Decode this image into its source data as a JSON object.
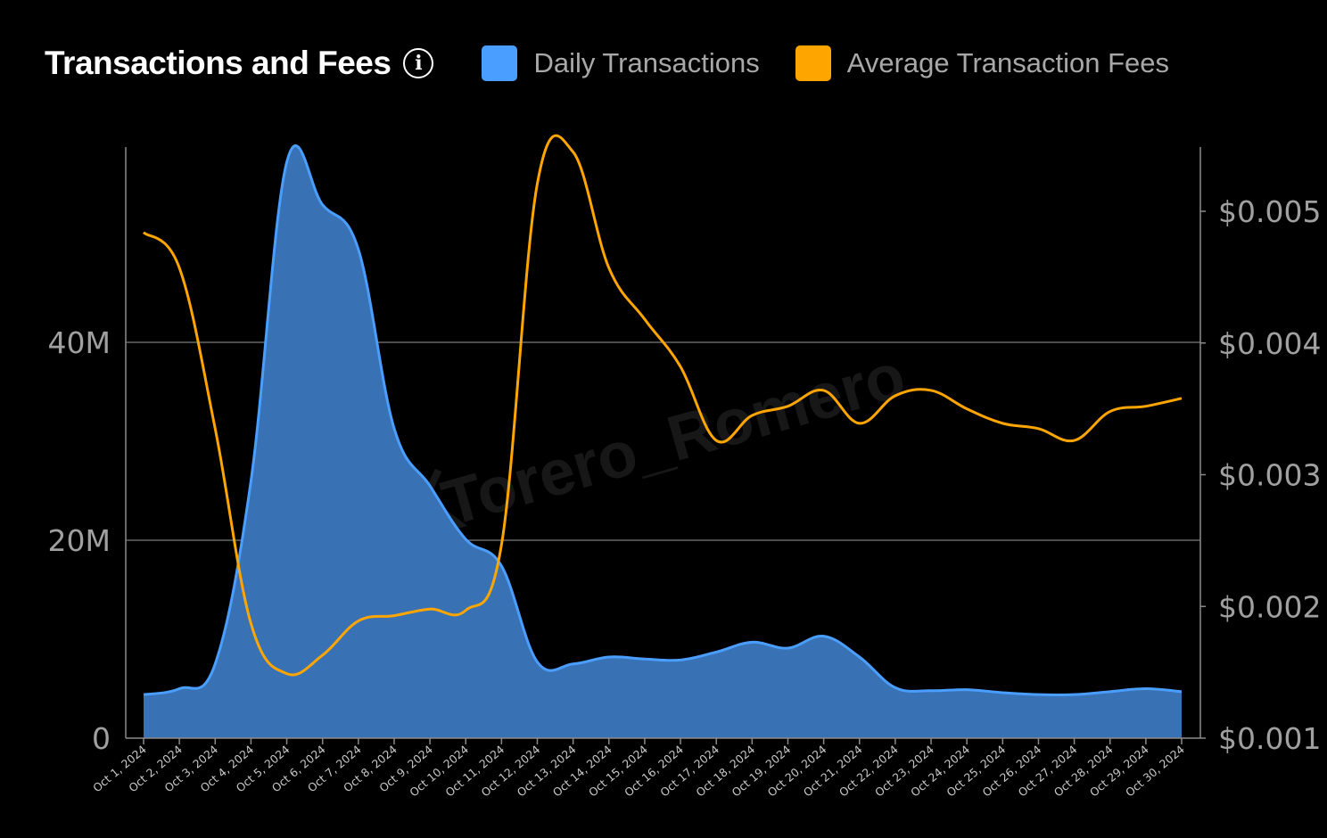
{
  "header": {
    "title": "Transactions and Fees",
    "info_icon": "i"
  },
  "legend": [
    {
      "label": "Daily Transactions",
      "color": "#4a9eff"
    },
    {
      "label": "Average Transaction Fees",
      "color": "#ffa500"
    }
  ],
  "watermark": "Torero_Romero",
  "chart_data": {
    "type": "area",
    "title": "Transactions and Fees",
    "categories": [
      "Oct 1, 2024",
      "Oct 2, 2024",
      "Oct 3, 2024",
      "Oct 4, 2024",
      "Oct 5, 2024",
      "Oct 6, 2024",
      "Oct 7, 2024",
      "Oct 8, 2024",
      "Oct 9, 2024",
      "Oct 10, 2024",
      "Oct 11, 2024",
      "Oct 12, 2024",
      "Oct 13, 2024",
      "Oct 14, 2024",
      "Oct 15, 2024",
      "Oct 16, 2024",
      "Oct 17, 2024",
      "Oct 18, 2024",
      "Oct 19, 2024",
      "Oct 20, 2024",
      "Oct 21, 2024",
      "Oct 22, 2024",
      "Oct 23, 2024",
      "Oct 24, 2024",
      "Oct 25, 2024",
      "Oct 26, 2024",
      "Oct 27, 2024",
      "Oct 28, 2024",
      "Oct 29, 2024",
      "Oct 30, 2024"
    ],
    "series": [
      {
        "name": "Daily Transactions",
        "type": "area",
        "axis": "left",
        "color": "#4a9eff",
        "fill": "#3872b5",
        "values": [
          4.4,
          5.0,
          7.5,
          26.0,
          58.2,
          53.9,
          49.4,
          31.3,
          25.5,
          20.1,
          17.4,
          7.7,
          7.5,
          8.2,
          8.0,
          7.9,
          8.7,
          9.7,
          9.1,
          10.3,
          8.2,
          5.1,
          4.8,
          4.9,
          4.6,
          4.4,
          4.4,
          4.7,
          5.0,
          4.7
        ],
        "unit": "M"
      },
      {
        "name": "Average Transaction Fees",
        "type": "line",
        "axis": "right",
        "color": "#ffa500",
        "values": [
          0.00484,
          0.00457,
          0.00335,
          0.00187,
          0.00149,
          0.00163,
          0.00189,
          0.00193,
          0.00198,
          0.00197,
          0.00247,
          0.00521,
          0.00545,
          0.00457,
          0.00418,
          0.00382,
          0.00326,
          0.00345,
          0.00352,
          0.00364,
          0.00339,
          0.0036,
          0.00364,
          0.0035,
          0.00339,
          0.00335,
          0.00326,
          0.00348,
          0.00352,
          0.00358
        ],
        "unit": "$"
      }
    ],
    "left_axis": {
      "ticks": [
        0,
        20,
        40
      ],
      "tick_labels": [
        "0",
        "20M",
        "40M"
      ],
      "ylim": [
        0,
        60
      ]
    },
    "right_axis": {
      "ticks": [
        0.001,
        0.002,
        0.003,
        0.004,
        0.005
      ],
      "tick_labels": [
        "$0.001",
        "$0.002",
        "$0.003",
        "$0.004",
        "$0.005"
      ],
      "ylim": [
        0.001,
        0.0055
      ]
    },
    "xlabel": "",
    "ylabel": "",
    "grid": "horizontal at left-axis ticks",
    "legend_position": "top"
  }
}
